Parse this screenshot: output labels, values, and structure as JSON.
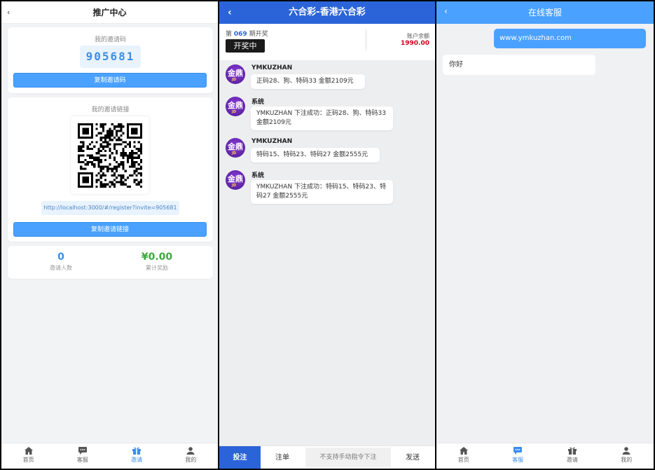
{
  "promo": {
    "back": "‹",
    "title": "推广中心",
    "invite_code_label": "我的邀请码",
    "invite_code": "905681",
    "copy_code_button": "复制邀请码",
    "invite_link_label": "我的邀请链接",
    "invite_link": "http://localhost:3000/#/register?invite=905681",
    "copy_link_button": "复制邀请链接",
    "invited_count": "0",
    "invited_label": "邀请人数",
    "reward_total": "¥0.00",
    "reward_label": "累计奖励",
    "colors": {
      "accent": "#4aa1ff",
      "count": "#3b8ee8",
      "reward": "#3aad3a"
    }
  },
  "tabbar": {
    "items": [
      {
        "label": "首页",
        "icon": "home-icon"
      },
      {
        "label": "客服",
        "icon": "chat-icon"
      },
      {
        "label": "邀请",
        "icon": "gift-icon"
      },
      {
        "label": "我的",
        "icon": "user-icon"
      }
    ],
    "promo_active": "邀请",
    "cs_active": "客服"
  },
  "lottery": {
    "back": "‹",
    "title": "六合彩-香港六合彩",
    "period_prefix": "第",
    "period_number": "069",
    "period_suffix": "期开奖",
    "status": "开奖中",
    "balance_label": "账户余额",
    "balance": "1990.00",
    "avatar_text": "金鼎",
    "avatar_sub": "JD",
    "messages": [
      {
        "sender": "YMKUZHAN",
        "text": "正码28、狗、特码33 金额2109元"
      },
      {
        "sender": "系统",
        "text": "YMKUZHAN 下注成功：正码28、狗、特码33 金额2109元"
      },
      {
        "sender": "YMKUZHAN",
        "text": "特码15、特码23、特码27 金额2555元"
      },
      {
        "sender": "系统",
        "text": "YMKUZHAN 下注成功：特码15、特码23、特码27 金额2555元"
      }
    ],
    "bottom": {
      "bet": "投注",
      "orders": "注单",
      "input_placeholder": "不支持手动指令下注",
      "send": "发送"
    },
    "colors": {
      "header": "#2b64d8",
      "balance": "#d0021b"
    }
  },
  "support": {
    "back": "‹",
    "title": "在线客服",
    "messages": [
      {
        "from": "user",
        "text": "www.ymkuzhan.com"
      },
      {
        "from": "agent",
        "text": "你好"
      }
    ]
  }
}
